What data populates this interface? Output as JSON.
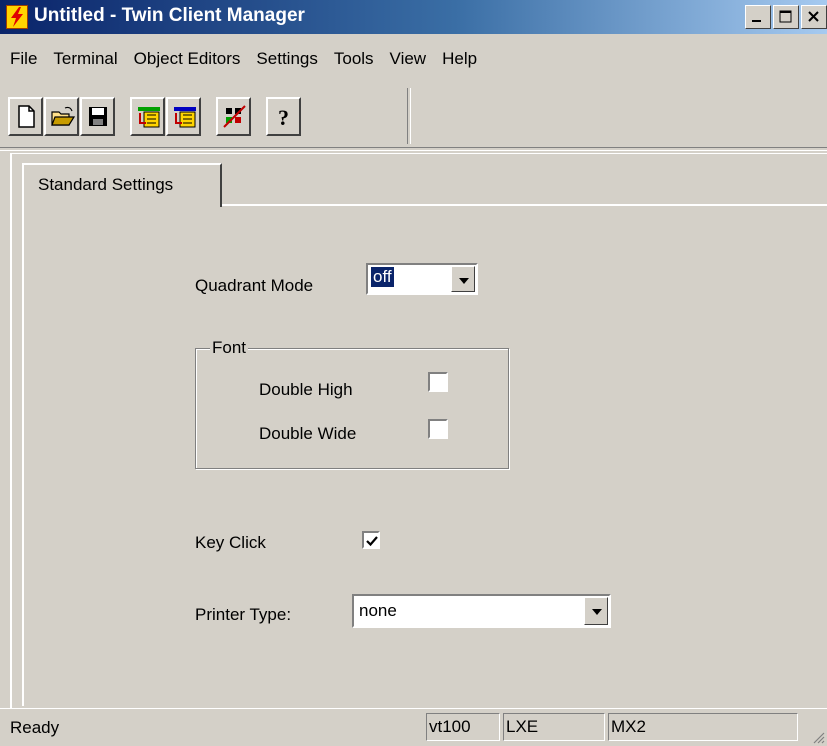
{
  "window": {
    "title": "Untitled - Twin Client Manager",
    "app_icon": "lightning-bolt-icon",
    "controls": [
      "minimize-icon",
      "maximize-icon",
      "close-icon"
    ]
  },
  "menu": [
    "File",
    "Terminal",
    "Object Editors",
    "Settings",
    "Tools",
    "View",
    "Help"
  ],
  "toolbar": [
    "new-document-icon",
    "open-folder-icon",
    "save-disk-icon",
    "import-icon",
    "export-icon",
    "transfer-icon",
    "help-icon"
  ],
  "tab": {
    "label": "Standard Settings"
  },
  "form": {
    "quadrant_mode": {
      "label": "Quadrant Mode",
      "value": "off"
    },
    "font_group": {
      "legend": "Font",
      "double_high": {
        "label": "Double High",
        "checked": false
      },
      "double_wide": {
        "label": "Double Wide",
        "checked": false
      }
    },
    "key_click": {
      "label": "Key Click",
      "checked": true
    },
    "printer_type": {
      "label": "Printer Type:",
      "value": "none"
    }
  },
  "status": {
    "text": "Ready",
    "pane1": "vt100",
    "pane2": "LXE",
    "pane3": "MX2"
  }
}
